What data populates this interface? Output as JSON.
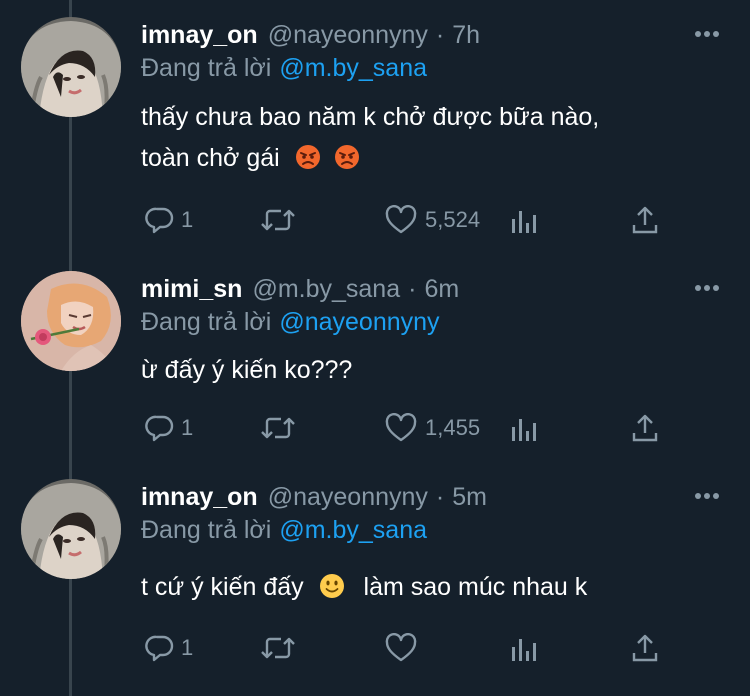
{
  "replying_label": "Đang trả lời",
  "tweets": [
    {
      "display_name": "imnay_on",
      "handle": "@nayeonnyny",
      "time": "7h",
      "reply_to": "@m.by_sana",
      "text_line1": "thấy chưa bao năm k chở được bữa nào,",
      "text_line2": "toàn chở gái",
      "emoji": "angry-face-emoji",
      "reply_count": "1",
      "retweet_count": "",
      "like_count": "5,524"
    },
    {
      "display_name": "mimi_sn",
      "handle": "@m.by_sana",
      "time": "6m",
      "reply_to": "@nayeonnyny",
      "text_line1": "ừ đấy ý kiến ko???",
      "reply_count": "1",
      "retweet_count": "",
      "like_count": "1,455"
    },
    {
      "display_name": "imnay_on",
      "handle": "@nayeonnyny",
      "time": "5m",
      "reply_to": "@m.by_sana",
      "text_part1": "t cứ ý kiến đấy",
      "emoji": "slightly-smiling-face-emoji",
      "text_part2": "làm sao múc nhau k",
      "reply_count": "1",
      "retweet_count": "",
      "like_count": ""
    }
  ],
  "colors": {
    "background": "#15202b",
    "primary_text": "#ffffff",
    "secondary_text": "#8899a6",
    "mention": "#1da1f2",
    "thread_line": "#38444d"
  }
}
